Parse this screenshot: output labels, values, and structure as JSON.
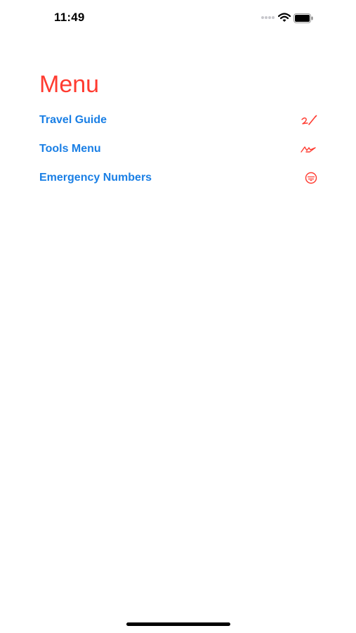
{
  "status_bar": {
    "time": "11:49"
  },
  "page": {
    "title": "Menu"
  },
  "menu": {
    "items": [
      {
        "label": "Travel Guide",
        "icon": "signature-icon"
      },
      {
        "label": "Tools Menu",
        "icon": "scribble-icon"
      },
      {
        "label": "Emergency Numbers",
        "icon": "sos-icon"
      }
    ]
  },
  "colors": {
    "title": "#FF3B30",
    "link": "#1A7FE5",
    "icon": "#FF3B30",
    "background": "#FFFFFF"
  }
}
